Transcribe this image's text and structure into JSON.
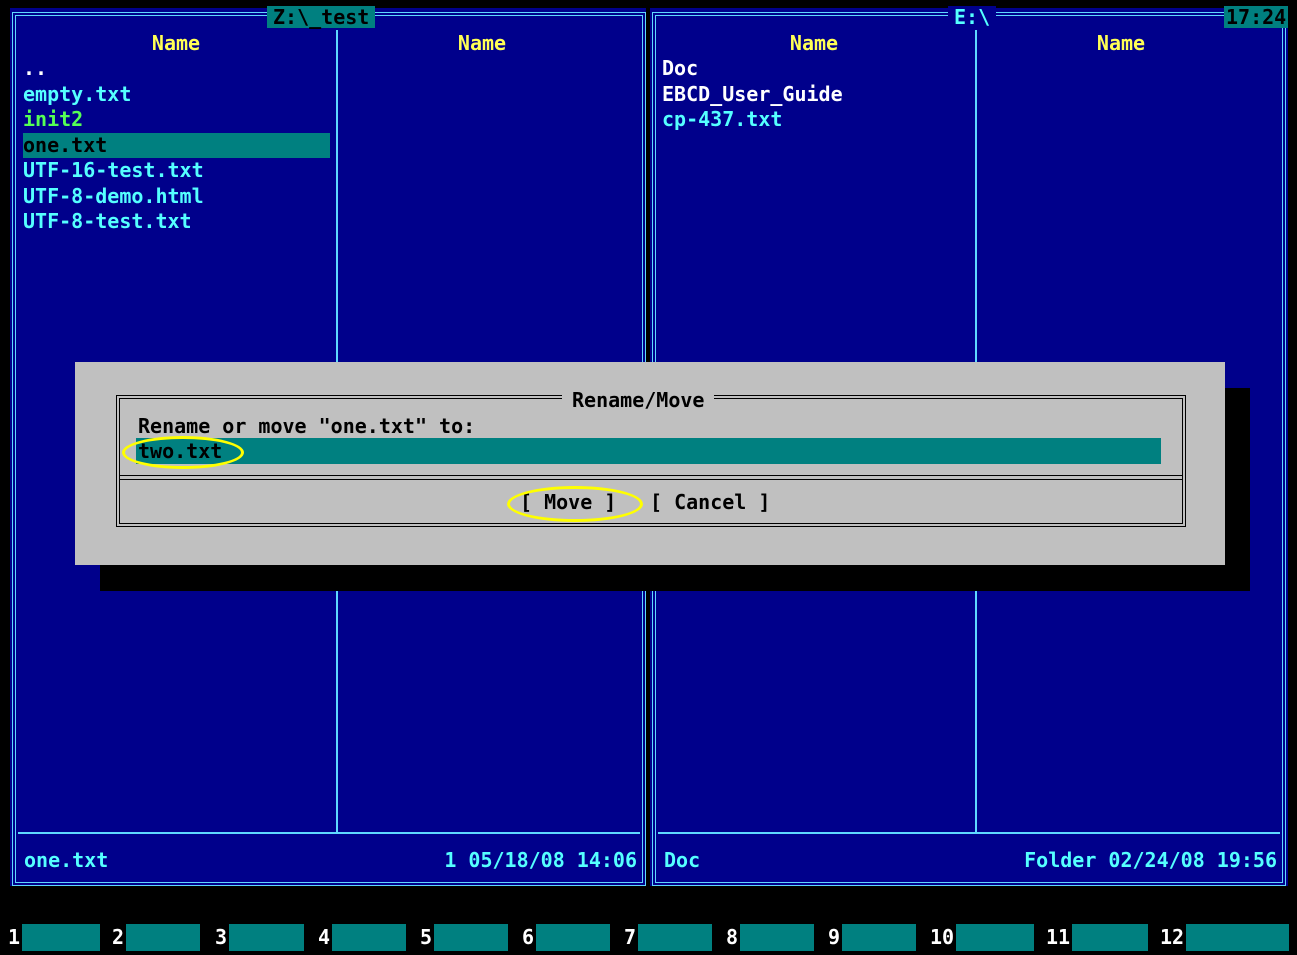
{
  "left_panel": {
    "title": "Z:\\_test",
    "col1_header": "Name",
    "col2_header": "Name",
    "files": [
      {
        "name": "..",
        "color": "#ffffff"
      },
      {
        "name": "empty.txt",
        "color": "#55ffff"
      },
      {
        "name": "init2",
        "color": "#55ff55"
      },
      {
        "name": "one.txt",
        "color": "#000000",
        "selected": true
      },
      {
        "name": "UTF-16-test.txt",
        "color": "#55ffff"
      },
      {
        "name": "UTF-8-demo.html",
        "color": "#55ffff"
      },
      {
        "name": "UTF-8-test.txt",
        "color": "#55ffff"
      }
    ],
    "status_name": "one.txt",
    "status_info": "1 05/18/08 14:06"
  },
  "right_panel": {
    "title": "E:\\",
    "clock": "17:24",
    "col1_header": "Name",
    "col2_header": "Name",
    "files": [
      {
        "name": "Doc",
        "color": "#ffffff"
      },
      {
        "name": "EBCD_User_Guide",
        "color": "#ffffff"
      },
      {
        "name": "cp-437.txt",
        "color": "#55ffff"
      }
    ],
    "status_name": "Doc",
    "status_info": "Folder 02/24/08 19:56"
  },
  "dialog": {
    "title": "Rename/Move",
    "prompt": "Rename or move \"one.txt\" to:",
    "input_value": "two.txt",
    "move_label": "[ Move ]",
    "cancel_label": "[ Cancel ]"
  },
  "fkeys": [
    "1",
    "2",
    "3",
    "4",
    "5",
    "6",
    "7",
    "8",
    "9",
    "10",
    "11",
    "12"
  ]
}
